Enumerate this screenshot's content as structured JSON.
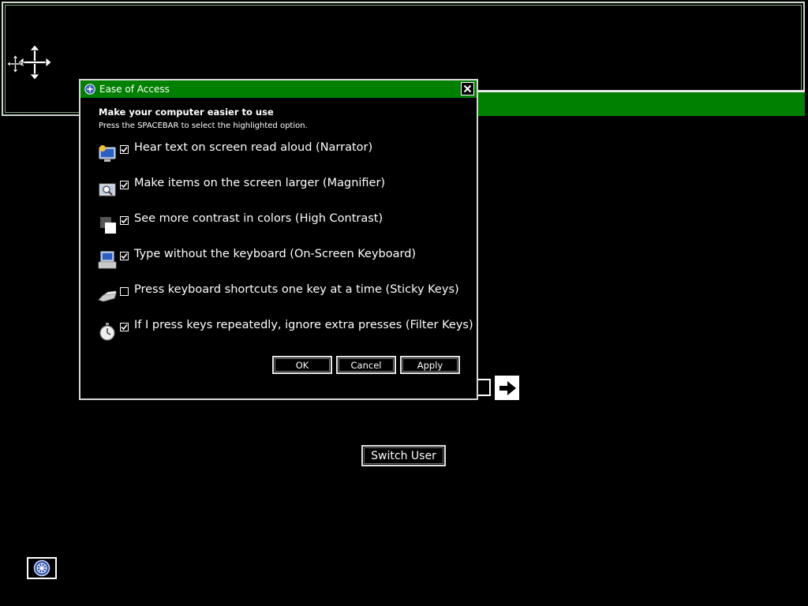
{
  "dialog": {
    "title": "Ease of Access",
    "heading": "Make your computer easier to use",
    "subheading": "Press the SPACEBAR to select the highlighted option.",
    "options": [
      {
        "label": "Hear text on screen read aloud (Narrator)",
        "checked": true,
        "icon": "narrator-icon"
      },
      {
        "label": "Make items on the screen larger (Magnifier)",
        "checked": true,
        "icon": "magnifier-icon"
      },
      {
        "label": "See more contrast in colors (High Contrast)",
        "checked": true,
        "icon": "high-contrast-icon"
      },
      {
        "label": "Type without the keyboard (On-Screen Keyboard)",
        "checked": true,
        "icon": "on-screen-keyboard-icon"
      },
      {
        "label": "Press keyboard shortcuts one key at a time (Sticky Keys)",
        "checked": false,
        "icon": "sticky-keys-icon"
      },
      {
        "label": "If I press keys repeatedly, ignore extra presses (Filter Keys)",
        "checked": true,
        "icon": "filter-keys-icon"
      }
    ],
    "buttons": {
      "ok": "OK",
      "cancel": "Cancel",
      "apply": "Apply"
    }
  },
  "logon": {
    "switch_user": "Switch User"
  },
  "colors": {
    "titlebar": "#008000",
    "background": "#000000",
    "foreground": "#ffffff"
  }
}
